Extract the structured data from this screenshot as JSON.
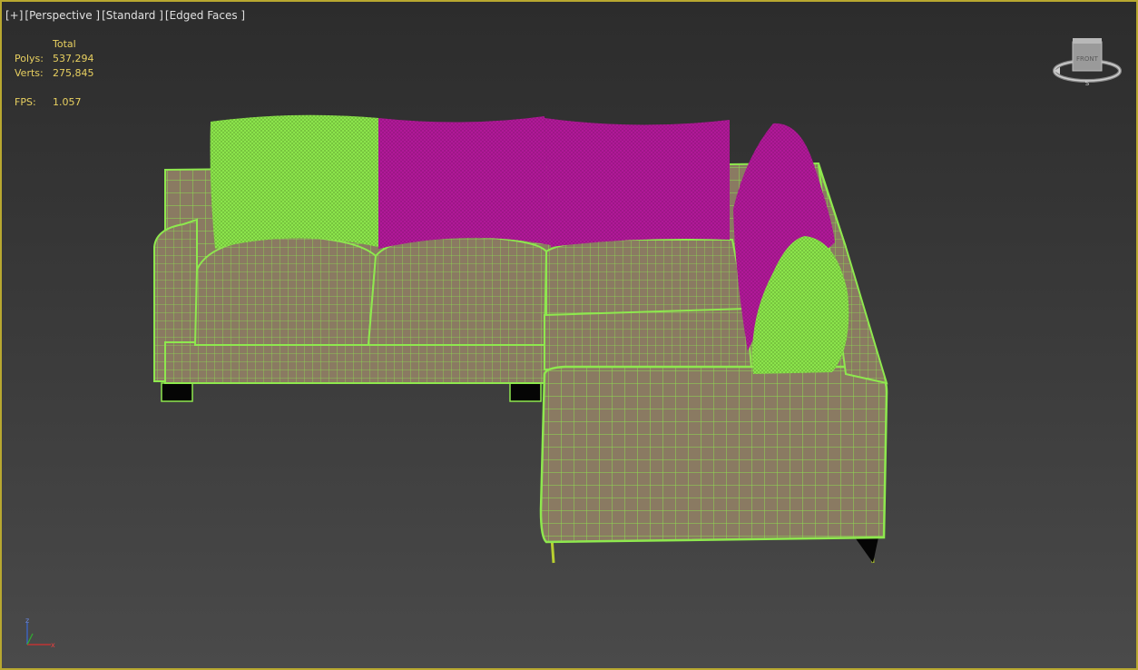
{
  "viewport": {
    "label_items": [
      "[+]",
      "[Perspective ]",
      "[Standard ]",
      "[Edged Faces ]"
    ]
  },
  "stats": {
    "header": "Total",
    "polys_label": "Polys:",
    "polys_value": "537,294",
    "verts_label": "Verts:",
    "verts_value": "275,845",
    "fps_label": "FPS:",
    "fps_value": "1.057"
  },
  "viewcube": {
    "face_label": "FRONT",
    "compass_label": "S"
  },
  "axis_tripod": {
    "z": "z",
    "x": "x"
  },
  "colors": {
    "viewport_border": "#b8a830",
    "wire_green": "#8ee84e",
    "magenta": "#b3199a",
    "surface": "#8a7a62",
    "stats_text": "#e8d060"
  }
}
